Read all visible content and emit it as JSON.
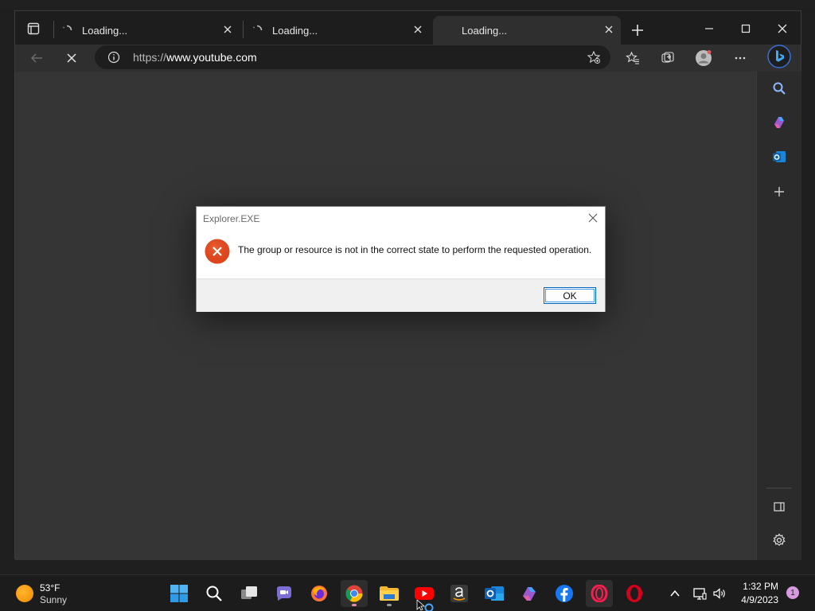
{
  "browser": {
    "tabs": [
      {
        "label": "Loading...",
        "active": false
      },
      {
        "label": "Loading...",
        "active": false
      },
      {
        "label": "Loading...",
        "active": true
      }
    ],
    "address": {
      "scheme": "https://",
      "host": "www.youtube.com"
    }
  },
  "sidebar": {
    "items": [
      "search-icon",
      "copilot-icon",
      "outlook-icon",
      "add-icon",
      "split-screen-icon",
      "settings-icon"
    ]
  },
  "dialog": {
    "title": "Explorer.EXE",
    "message": "The group or resource is not in the correct state to perform the requested operation.",
    "ok_label": "OK"
  },
  "taskbar": {
    "weather": {
      "temp": "53°F",
      "condition": "Sunny"
    },
    "apps": [
      "start",
      "search",
      "task-view",
      "chat",
      "firefox",
      "chrome",
      "file-explorer",
      "youtube",
      "amazon",
      "outlook",
      "copilot",
      "facebook",
      "opera-gx",
      "opera"
    ],
    "clock": {
      "time": "1:32 PM",
      "date": "4/9/2023"
    },
    "notifications": "1"
  },
  "colors": {
    "accent": "#0067c0",
    "error": "#e0461f",
    "content_bg": "#353535"
  }
}
